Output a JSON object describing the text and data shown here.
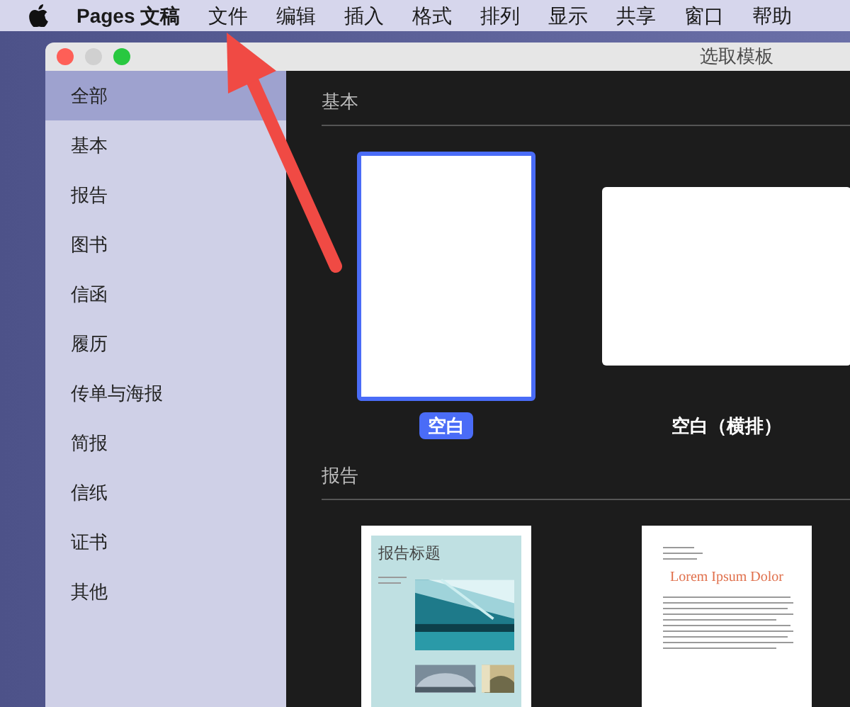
{
  "menu_bar": {
    "app_name": "Pages 文稿",
    "items": [
      "文件",
      "编辑",
      "插入",
      "格式",
      "排列",
      "显示",
      "共享",
      "窗口",
      "帮助"
    ]
  },
  "window": {
    "title": "选取模板"
  },
  "sidebar": {
    "items": [
      {
        "label": "全部",
        "selected": true
      },
      {
        "label": "基本",
        "selected": false
      },
      {
        "label": "报告",
        "selected": false
      },
      {
        "label": "图书",
        "selected": false
      },
      {
        "label": "信函",
        "selected": false
      },
      {
        "label": "履历",
        "selected": false
      },
      {
        "label": "传单与海报",
        "selected": false
      },
      {
        "label": "简报",
        "selected": false
      },
      {
        "label": "信纸",
        "selected": false
      },
      {
        "label": "证书",
        "selected": false
      },
      {
        "label": "其他",
        "selected": false
      }
    ]
  },
  "sections": [
    {
      "title": "基本",
      "templates": [
        {
          "kind": "portrait",
          "label": "空白",
          "selected": true
        },
        {
          "kind": "landscape",
          "label": "空白（横排）",
          "selected": false
        }
      ]
    },
    {
      "title": "报告",
      "templates": [
        {
          "kind": "photo-report",
          "heading": "报告标题",
          "selected": false
        },
        {
          "kind": "letter-report",
          "heading": "Lorem Ipsum Dolor",
          "selected": false
        }
      ]
    }
  ]
}
